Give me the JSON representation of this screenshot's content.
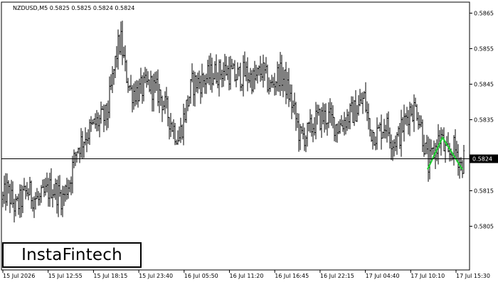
{
  "chart_data": {
    "type": "candlestick",
    "title": "NZDUSD,M5  0.5825 0.5825 0.5824 0.5824",
    "symbol": "NZDUSD",
    "timeframe": "M5",
    "ohlc_readout": {
      "open": 0.5825,
      "high": 0.5825,
      "low": 0.5824,
      "close": 0.5824
    },
    "current_price": 0.5824,
    "current_price_label": "0.5824",
    "ylim": [
      0.58,
      0.587
    ],
    "y_ticks": [
      "0.5865",
      "0.5855",
      "0.5845",
      "0.5835",
      "0.5825",
      "0.5815",
      "0.5805"
    ],
    "y_tick_values": [
      0.5865,
      0.5855,
      0.5845,
      0.5835,
      0.5825,
      0.5815,
      0.5805
    ],
    "x_ticks": [
      "15 Jul 2026",
      "15 Jul 12:55",
      "15 Jul 18:15",
      "15 Jul 23:40",
      "16 Jul 05:50",
      "16 Jul 11:20",
      "16 Jul 16:45",
      "16 Jul 22:15",
      "17 Jul 04:40",
      "17 Jul 10:10",
      "17 Jul 15:30"
    ],
    "grid": false,
    "price_path": [
      [
        0,
        0.5811
      ],
      [
        10,
        0.5815
      ],
      [
        22,
        0.581
      ],
      [
        38,
        0.5815
      ],
      [
        55,
        0.5812
      ],
      [
        72,
        0.5816
      ],
      [
        88,
        0.5813
      ],
      [
        98,
        0.5818
      ],
      [
        108,
        0.5827
      ],
      [
        122,
        0.5831
      ],
      [
        135,
        0.5834
      ],
      [
        150,
        0.5836
      ],
      [
        158,
        0.5846
      ],
      [
        165,
        0.5855
      ],
      [
        170,
        0.5857
      ],
      [
        176,
        0.5849
      ],
      [
        184,
        0.5843
      ],
      [
        195,
        0.5843
      ],
      [
        210,
        0.5845
      ],
      [
        225,
        0.5842
      ],
      [
        235,
        0.5837
      ],
      [
        245,
        0.5832
      ],
      [
        252,
        0.583
      ],
      [
        260,
        0.5837
      ],
      [
        270,
        0.5845
      ],
      [
        285,
        0.5846
      ],
      [
        300,
        0.5848
      ],
      [
        318,
        0.5849
      ],
      [
        330,
        0.5847
      ],
      [
        345,
        0.5848
      ],
      [
        358,
        0.5846
      ],
      [
        368,
        0.5849
      ],
      [
        380,
        0.5844
      ],
      [
        392,
        0.5848
      ],
      [
        400,
        0.5846
      ],
      [
        408,
        0.5841
      ],
      [
        415,
        0.5836
      ],
      [
        422,
        0.583
      ],
      [
        432,
        0.5831
      ],
      [
        445,
        0.5835
      ],
      [
        460,
        0.5836
      ],
      [
        475,
        0.5833
      ],
      [
        490,
        0.5836
      ],
      [
        502,
        0.5838
      ],
      [
        512,
        0.5841
      ],
      [
        520,
        0.5832
      ],
      [
        530,
        0.5831
      ],
      [
        542,
        0.5834
      ],
      [
        552,
        0.5829
      ],
      [
        560,
        0.583
      ],
      [
        568,
        0.5834
      ],
      [
        576,
        0.5838
      ],
      [
        586,
        0.5838
      ],
      [
        592,
        0.5833
      ],
      [
        598,
        0.5826
      ],
      [
        602,
        0.5822
      ],
      [
        610,
        0.5826
      ],
      [
        616,
        0.5829
      ],
      [
        620,
        0.583
      ],
      [
        624,
        0.5827
      ],
      [
        630,
        0.5824
      ],
      [
        636,
        0.5827
      ],
      [
        642,
        0.5826
      ],
      [
        648,
        0.5822
      ],
      [
        652,
        0.5824
      ]
    ],
    "pattern_line": [
      [
        601,
        0.5821
      ],
      [
        622,
        0.583
      ],
      [
        650,
        0.5821
      ]
    ],
    "pattern_color": "#22cc33"
  },
  "branding": {
    "logo_text": "InstaFintech"
  }
}
